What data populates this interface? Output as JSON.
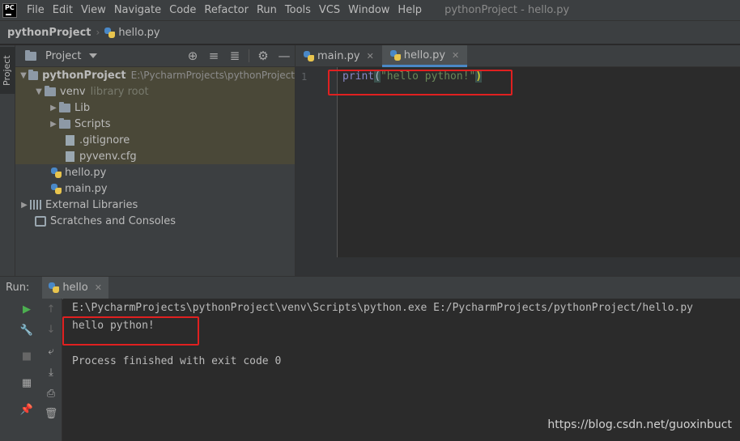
{
  "app": {
    "logo_text": "PC",
    "menu": [
      "File",
      "Edit",
      "View",
      "Navigate",
      "Code",
      "Refactor",
      "Run",
      "Tools",
      "VCS",
      "Window",
      "Help"
    ],
    "window_title": "pythonProject - hello.py"
  },
  "breadcrumb": {
    "project": "pythonProject",
    "file": "hello.py"
  },
  "sidebar": {
    "tab_label": "Project"
  },
  "project_panel": {
    "title": "Project",
    "tree": {
      "root_name": "pythonProject",
      "root_path": "E:\\PycharmProjects\\pythonProject",
      "venv_name": "venv",
      "venv_note": "library root",
      "lib": "Lib",
      "scripts": "Scripts",
      "gitignore": ".gitignore",
      "pyvenv": "pyvenv.cfg",
      "hello": "hello.py",
      "main": "main.py",
      "external": "External Libraries",
      "scratches": "Scratches and Consoles"
    }
  },
  "editor": {
    "tabs": [
      "main.py",
      "hello.py"
    ],
    "active_tab": "hello.py",
    "line_number": "1",
    "code": {
      "func": "print",
      "open": "(",
      "string": "\"hello python!\"",
      "close": ")"
    }
  },
  "run": {
    "label": "Run:",
    "tab": "hello",
    "console": {
      "command": "E:\\PycharmProjects\\pythonProject\\venv\\Scripts\\python.exe E:/PycharmProjects/pythonProject/hello.py",
      "output": "hello python!",
      "exit": "Process finished with exit code 0"
    }
  },
  "watermark": "https://blog.csdn.net/guoxinbuct",
  "colors": {
    "highlight_box": "#e02020",
    "active_tab_underline": "#4a88c7"
  }
}
